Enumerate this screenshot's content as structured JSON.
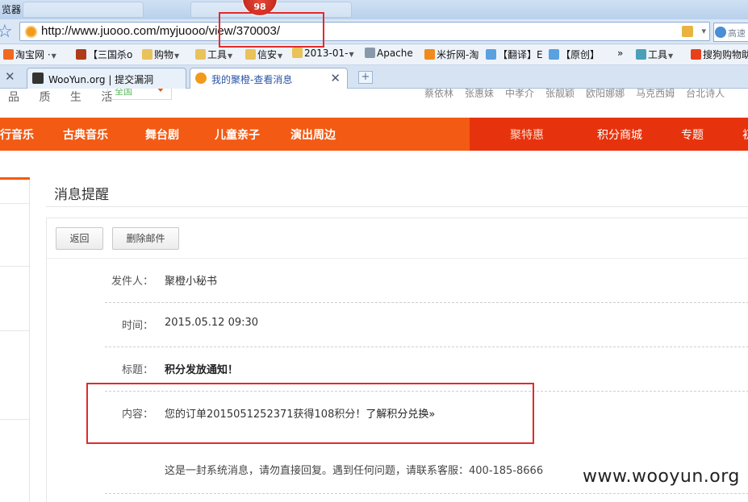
{
  "browser": {
    "title": "览器",
    "badge_count": "98",
    "url": "http://www.juooo.com/myjuooo/view/370003/",
    "speed_label": "高速"
  },
  "favorites": [
    {
      "label": "淘宝网 ·",
      "color": "#f0691f",
      "arrow": true
    },
    {
      "label": "【三国杀o",
      "color": "#b03a1a",
      "arrow": false
    },
    {
      "label": "购物",
      "color": "#e9c25a",
      "arrow": true
    },
    {
      "label": "工具",
      "color": "#e9c25a",
      "arrow": true
    },
    {
      "label": "信安",
      "color": "#e9c25a",
      "arrow": true
    },
    {
      "label": "2013-01-",
      "color": "#e9c25a",
      "arrow": true
    },
    {
      "label": "Apache",
      "color": "#8899aa",
      "arrow": false
    },
    {
      "label": "米折网-淘",
      "color": "#f08a1c",
      "arrow": false
    },
    {
      "label": "【翻译】E",
      "color": "#5aa1e0",
      "arrow": false
    },
    {
      "label": "【原创】",
      "color": "#5aa1e0",
      "arrow": false
    },
    {
      "label": "»",
      "color": "",
      "arrow": false
    },
    {
      "label": "工具",
      "color": "#4aa0b8",
      "arrow": true
    },
    {
      "label": "搜狗购物助",
      "color": "#e8401c",
      "arrow": false
    }
  ],
  "tabs": [
    {
      "title": "WooYun.org | 提交漏洞",
      "active": false
    },
    {
      "title": "我的聚橙-查看消息",
      "active": true
    }
  ],
  "site": {
    "slogan": "品 质 生 活",
    "region": "全国",
    "artists": [
      "蔡依林",
      "张惠妹",
      "中孝介",
      "张靓颖",
      "欧阳娜娜",
      "马克西姆",
      "台北诗人"
    ],
    "nav": [
      "行音乐",
      "古典音乐",
      "舞台剧",
      "儿童亲子",
      "演出周边"
    ],
    "promo_nav": [
      "聚特惠",
      "积分商城",
      "专题",
      "初"
    ]
  },
  "message": {
    "section_title": "消息提醒",
    "back_button": "返回",
    "delete_button": "删除邮件",
    "sender_label": "发件人：",
    "sender": "聚橙小秘书",
    "time_label": "时间：",
    "time": "2015.05.12 09:30",
    "subject_label": "标题：",
    "subject": "积分发放通知！",
    "content_label": "内容：",
    "content": "您的订单2015051252371获得108积分！",
    "content_link": "了解积分兑换»",
    "note": "这是一封系统消息，请勿直接回复。遇到任何问题，请联系客服：400-185-8666"
  },
  "watermark": "www.wooyun.org",
  "colors": {
    "brand_orange": "#f35a13",
    "promo_red": "#e7330d",
    "annotation_red": "#e32a2a"
  }
}
